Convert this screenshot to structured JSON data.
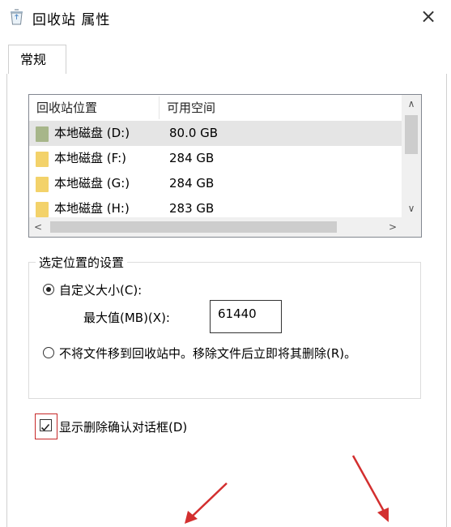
{
  "window": {
    "title": "回收站 属性",
    "close_glyph": "×"
  },
  "tabs": [
    {
      "label": "常规"
    }
  ],
  "list": {
    "columns": [
      "回收站位置",
      "可用空间"
    ],
    "rows": [
      {
        "name": "本地磁盘 (D:)",
        "space": "80.0 GB",
        "icon_color": "#a7b68a"
      },
      {
        "name": "本地磁盘 (F:)",
        "space": "284 GB",
        "icon_color": "#f3d26a"
      },
      {
        "name": "本地磁盘 (G:)",
        "space": "284 GB",
        "icon_color": "#f3d26a"
      },
      {
        "name": "本地磁盘 (H:)",
        "space": "283 GB",
        "icon_color": "#f3d26a"
      }
    ],
    "selected_index": 0
  },
  "settings": {
    "legend": "选定位置的设置",
    "custom_size_label": "自定义大小(C):",
    "max_label": "最大值(MB)(X):",
    "max_value": "61440",
    "no_recycle_label": "不将文件移到回收站中。移除文件后立即将其删除(R)。",
    "selected_option": "custom"
  },
  "confirm": {
    "label": "显示删除确认对话框(D)",
    "checked": true
  },
  "colors": {
    "annotation_red": "#d32f2f"
  }
}
